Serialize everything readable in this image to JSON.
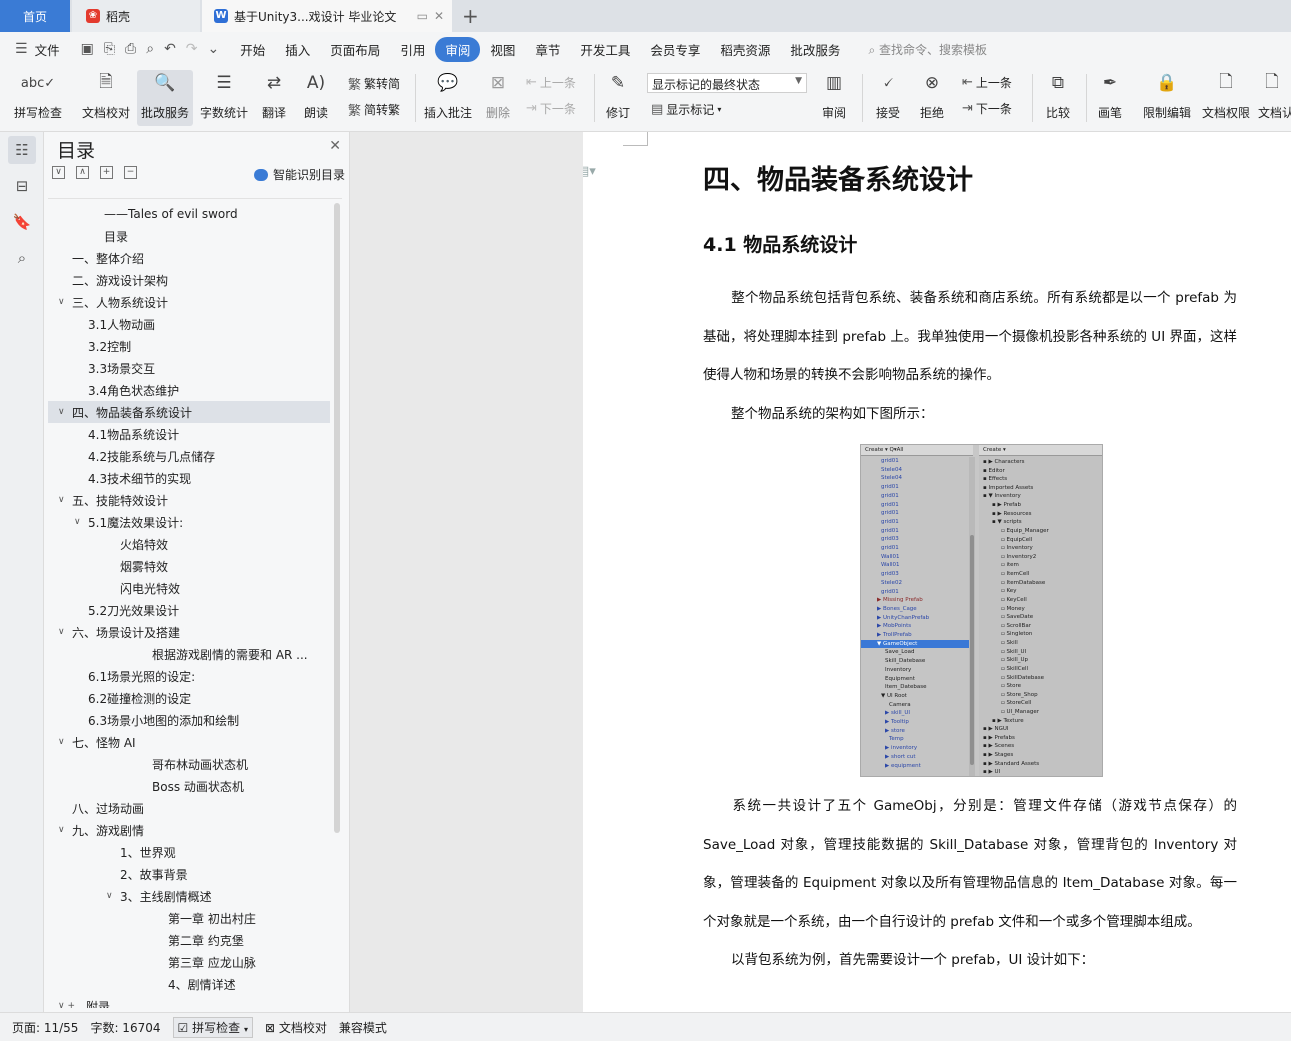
{
  "tabs": {
    "home": "首页",
    "daoke": "稻壳",
    "doc": "基于Unity3...戏设计 毕业论文"
  },
  "menu": {
    "file": "文件",
    "items": [
      "开始",
      "插入",
      "页面布局",
      "引用",
      "审阅",
      "视图",
      "章节",
      "开发工具",
      "会员专享",
      "稻壳资源",
      "批改服务"
    ],
    "active": "审阅",
    "search": "查找命令、搜索模板"
  },
  "ribbon": {
    "spell": "拼写检查",
    "proof": "文档校对",
    "review_service": "批改服务",
    "word_count": "字数统计",
    "translate": "翻译",
    "read_aloud": "朗读",
    "trad_to_simp": "繁转简",
    "simp_to_trad": "简转繁",
    "insert_comment": "插入批注",
    "delete": "删除",
    "prev_comment": "上一条",
    "next_comment": "下一条",
    "track": "修订",
    "markup_state": "显示标记的最终状态",
    "show_markup": "显示标记",
    "review": "审阅",
    "accept": "接受",
    "reject": "拒绝",
    "prev_change": "上一条",
    "next_change": "下一条",
    "compare": "比较",
    "pen": "画笔",
    "restrict": "限制编辑",
    "permission": "文档权限",
    "doc_more": "文档认"
  },
  "toc": {
    "title": "目录",
    "smart": "智能识别目录",
    "items": [
      {
        "text": "——Tales of evil sword",
        "level": 2,
        "caret": ""
      },
      {
        "text": "目录",
        "level": 2,
        "caret": ""
      },
      {
        "text": "一、整体介绍",
        "level": 0,
        "caret": ""
      },
      {
        "text": "二、游戏设计架构",
        "level": 0,
        "caret": ""
      },
      {
        "text": "三、人物系统设计",
        "level": 0,
        "caret": "v"
      },
      {
        "text": "3.1人物动画",
        "level": 1,
        "caret": ""
      },
      {
        "text": "3.2控制",
        "level": 1,
        "caret": ""
      },
      {
        "text": "3.3场景交互",
        "level": 1,
        "caret": ""
      },
      {
        "text": "3.4角色状态维护",
        "level": 1,
        "caret": ""
      },
      {
        "text": "四、物品装备系统设计",
        "level": 0,
        "caret": "v",
        "selected": true
      },
      {
        "text": "4.1物品系统设计",
        "level": 1,
        "caret": ""
      },
      {
        "text": "4.2技能系统与几点储存",
        "level": 1,
        "caret": ""
      },
      {
        "text": "4.3技术细节的实现",
        "level": 1,
        "caret": ""
      },
      {
        "text": "五、技能特效设计",
        "level": 0,
        "caret": "v"
      },
      {
        "text": "5.1魔法效果设计:",
        "level": 1,
        "caret": "v"
      },
      {
        "text": "火焰特效",
        "level": 3,
        "caret": ""
      },
      {
        "text": "烟雾特效",
        "level": 3,
        "caret": ""
      },
      {
        "text": "闪电光特效",
        "level": 3,
        "caret": ""
      },
      {
        "text": "5.2刀光效果设计",
        "level": 1,
        "caret": ""
      },
      {
        "text": "六、场景设计及搭建",
        "level": 0,
        "caret": "v"
      },
      {
        "text": "根据游戏剧情的需要和 AR ...",
        "level": 4,
        "caret": ""
      },
      {
        "text": "6.1场景光照的设定:",
        "level": 1,
        "caret": ""
      },
      {
        "text": "6.2碰撞检测的设定",
        "level": 1,
        "caret": ""
      },
      {
        "text": "6.3场景小地图的添加和绘制",
        "level": 1,
        "caret": ""
      },
      {
        "text": "七、怪物 AI",
        "level": 0,
        "caret": "v"
      },
      {
        "text": "哥布林动画状态机",
        "level": 4,
        "caret": ""
      },
      {
        "text": "Boss 动画状态机",
        "level": 4,
        "caret": ""
      },
      {
        "text": "八、过场动画",
        "level": 0,
        "caret": ""
      },
      {
        "text": "九、游戏剧情",
        "level": 0,
        "caret": "v"
      },
      {
        "text": "1、世界观",
        "level": 3,
        "caret": ""
      },
      {
        "text": "2、故事背景",
        "level": 3,
        "caret": ""
      },
      {
        "text": "3、主线剧情概述",
        "level": 3,
        "caret": "v"
      },
      {
        "text": "第一章 初出村庄",
        "level": 5,
        "caret": ""
      },
      {
        "text": "第二章 约克堡",
        "level": 5,
        "caret": ""
      },
      {
        "text": "第三章 应龙山脉",
        "level": 5,
        "caret": ""
      },
      {
        "text": "4、剧情详述",
        "level": 5,
        "caret": ""
      },
      {
        "text": "附录",
        "level": 0,
        "caret": "v +"
      }
    ]
  },
  "doc": {
    "h1": "四、物品装备系统设计",
    "h2": "4.1  物品系统设计",
    "p1": "整个物品系统包括背包系统、装备系统和商店系统。所有系统都是以一个 prefab 为基础，将处理脚本挂到 prefab 上。我单独使用一个摄像机投影各种系统的 UI 界面，这样使得人物和场景的转换不会影响物品系统的操作。",
    "p2": "整个物品系统的架构如下图所示：",
    "p3": "系统一共设计了五个 GameObj，分别是：管理文件存储（游戏节点保存）的 Save_Load 对象，管理技能数据的 Skill_Database 对象，管理背包的 Inventory 对象，管理装备的 Equipment 对象以及所有管理物品信息的 Item_Database 对象。每一个对象就是一个系统，由一个自行设计的 prefab 文件和一个或多个管理脚本组成。",
    "p4": "以背包系统为例，首先需要设计一个 prefab，UI 设计如下："
  },
  "screenshot": {
    "left_header": "Create ▾  Q▾All",
    "right_header": "Create ▾",
    "left_lines": [
      {
        "t": "grid01",
        "c": "blue",
        "i": 1
      },
      {
        "t": "Stele04",
        "c": "blue",
        "i": 1
      },
      {
        "t": "Stele04",
        "c": "blue",
        "i": 1
      },
      {
        "t": "grid01",
        "c": "blue",
        "i": 1
      },
      {
        "t": "grid01",
        "c": "blue",
        "i": 1
      },
      {
        "t": "grid01",
        "c": "blue",
        "i": 1
      },
      {
        "t": "grid01",
        "c": "blue",
        "i": 1
      },
      {
        "t": "grid01",
        "c": "blue",
        "i": 1
      },
      {
        "t": "grid01",
        "c": "blue",
        "i": 1
      },
      {
        "t": "grid03",
        "c": "blue",
        "i": 1
      },
      {
        "t": "grid01",
        "c": "blue",
        "i": 1
      },
      {
        "t": "Wall01",
        "c": "blue",
        "i": 1
      },
      {
        "t": "Wall01",
        "c": "blue",
        "i": 1
      },
      {
        "t": "grid03",
        "c": "blue",
        "i": 1
      },
      {
        "t": "Stele02",
        "c": "blue",
        "i": 1
      },
      {
        "t": "grid01",
        "c": "blue",
        "i": 1
      },
      {
        "t": "▶ Missing Prefab",
        "c": "red",
        "i": 0
      },
      {
        "t": "▶ Bones_Cage",
        "c": "blue",
        "i": 0
      },
      {
        "t": "▶ UnityChanPrefab",
        "c": "blue",
        "i": 0
      },
      {
        "t": "▶ MobPoints",
        "c": "blue",
        "i": 0
      },
      {
        "t": "▶ TrollPrefab",
        "c": "blue",
        "i": 0
      },
      {
        "t": "▼ GameObject",
        "c": "hl",
        "i": 0
      },
      {
        "t": "Save_Load",
        "c": "black",
        "i": 2
      },
      {
        "t": "Skill_Datebase",
        "c": "black",
        "i": 2
      },
      {
        "t": "Inventory",
        "c": "black",
        "i": 2
      },
      {
        "t": "Equipment",
        "c": "black",
        "i": 2
      },
      {
        "t": "Item_Datebase",
        "c": "black",
        "i": 2
      },
      {
        "t": "▼ UI Root",
        "c": "black",
        "i": 1
      },
      {
        "t": "Camera",
        "c": "black",
        "i": 3
      },
      {
        "t": "▶ skill_UI",
        "c": "blue",
        "i": 2
      },
      {
        "t": "▶ Tooltip",
        "c": "blue",
        "i": 2
      },
      {
        "t": "▶ store",
        "c": "blue",
        "i": 2
      },
      {
        "t": "Temp",
        "c": "blue",
        "i": 3
      },
      {
        "t": "▶ inventory",
        "c": "blue",
        "i": 2
      },
      {
        "t": "▶ short cut",
        "c": "blue",
        "i": 2
      },
      {
        "t": "▶ equipment",
        "c": "blue",
        "i": 2
      }
    ],
    "right_lines": [
      {
        "t": "▶ Characters",
        "i": 0
      },
      {
        "t": "Editor",
        "i": 0
      },
      {
        "t": "Effects",
        "i": 0
      },
      {
        "t": "Imported Assets",
        "i": 0
      },
      {
        "t": "▼ Inventory",
        "i": 0
      },
      {
        "t": "▶ Prefab",
        "i": 1
      },
      {
        "t": "▶ Resources",
        "i": 1
      },
      {
        "t": "▼ scripts",
        "i": 1
      },
      {
        "t": "Equip_Manager",
        "i": 2
      },
      {
        "t": "EquipCell",
        "i": 2
      },
      {
        "t": "Inventory",
        "i": 2
      },
      {
        "t": "Inventory2",
        "i": 2
      },
      {
        "t": "item",
        "i": 2
      },
      {
        "t": "ItemCell",
        "i": 2
      },
      {
        "t": "ItemDatabase",
        "i": 2
      },
      {
        "t": "Key",
        "i": 2
      },
      {
        "t": "KeyCell",
        "i": 2
      },
      {
        "t": "Money",
        "i": 2
      },
      {
        "t": "SaveDate",
        "i": 2
      },
      {
        "t": "ScrollBar",
        "i": 2
      },
      {
        "t": "Singleton",
        "i": 2
      },
      {
        "t": "Skill",
        "i": 2
      },
      {
        "t": "Skill_UI",
        "i": 2
      },
      {
        "t": "Skill_Up",
        "i": 2
      },
      {
        "t": "SkillCell",
        "i": 2
      },
      {
        "t": "SkillDatebase",
        "i": 2
      },
      {
        "t": "Store",
        "i": 2
      },
      {
        "t": "Store_Shop",
        "i": 2
      },
      {
        "t": "StoreCell",
        "i": 2
      },
      {
        "t": "UI_Manager",
        "i": 2
      },
      {
        "t": "▶ Texture",
        "i": 1
      },
      {
        "t": "▶ NGUI",
        "i": 0
      },
      {
        "t": "▶ Prefabs",
        "i": 0
      },
      {
        "t": "▶ Scenes",
        "i": 0
      },
      {
        "t": "▶ Stages",
        "i": 0
      },
      {
        "t": "▶ Standard Assets",
        "i": 0
      },
      {
        "t": "▶ UI",
        "i": 0
      }
    ]
  },
  "status": {
    "page": "页面: 11/55",
    "words": "字数: 16704",
    "spell": "拼写检查",
    "proof": "文档校对",
    "compat": "兼容模式"
  }
}
